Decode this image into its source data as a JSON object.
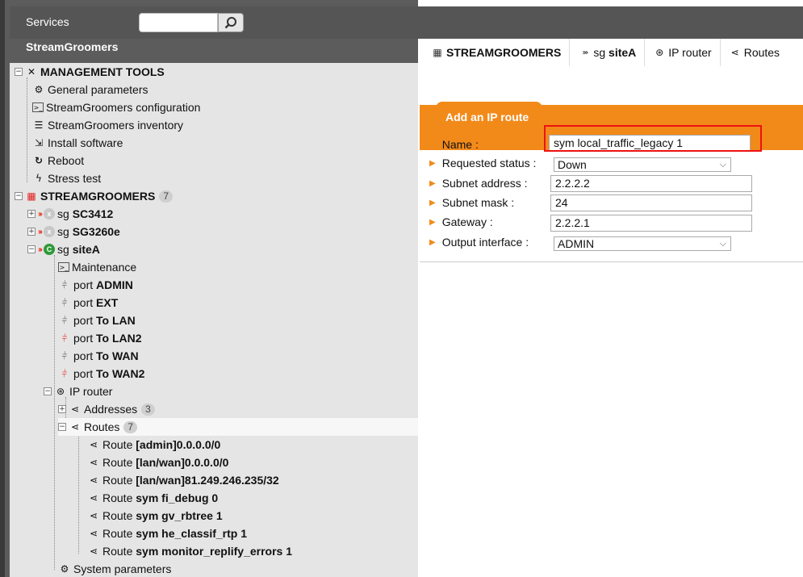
{
  "header": {
    "services_label": "Services",
    "search_placeholder": "",
    "brand": "StreamGroomers"
  },
  "tree": {
    "management_tools": "MANAGEMENT TOOLS",
    "general_parameters": "General parameters",
    "sg_configuration": "StreamGroomers configuration",
    "sg_inventory": "StreamGroomers inventory",
    "install_software": "Install software",
    "reboot": "Reboot",
    "stress_test": "Stress test",
    "streamgroomers": "STREAMGROOMERS",
    "streamgroomers_count": "7",
    "sg_prefix": "sg",
    "sg1_name": "SC3412",
    "sg2_name": "SG3260e",
    "sg3_name": "siteA",
    "maintenance": "Maintenance",
    "port_prefix": "port",
    "ports": [
      "ADMIN",
      "EXT",
      "To LAN",
      "To LAN2",
      "To WAN",
      "To WAN2"
    ],
    "ip_router": "IP router",
    "addresses": "Addresses",
    "addresses_count": "3",
    "routes": "Routes",
    "routes_count": "7",
    "route_prefix": "Route",
    "route_items": [
      "[admin]0.0.0.0/0",
      "[lan/wan]0.0.0.0/0",
      "[lan/wan]81.249.246.235/32",
      "sym fi_debug 0",
      "sym gv_rbtree 1",
      "sym he_classif_rtp 1",
      "sym monitor_replify_errors 1"
    ],
    "system_parameters": "System parameters"
  },
  "tabs": {
    "t1": "STREAMGROOMERS",
    "t2_prefix": "sg",
    "t2_name": "siteA",
    "t3": "IP router",
    "t4": "Routes"
  },
  "form": {
    "title": "Add an IP route",
    "name_label": "Name :",
    "name_value": "sym local_traffic_legacy 1",
    "status_label": "Requested status :",
    "status_value": "Down",
    "subnet_label": "Subnet address :",
    "subnet_value": "2.2.2.2",
    "mask_label": "Subnet mask :",
    "mask_value": "24",
    "gateway_label": "Gateway :",
    "gateway_value": "2.2.2.1",
    "output_label": "Output interface :",
    "output_value": "ADMIN"
  },
  "colors": {
    "accent_orange": "#f28a1a",
    "highlight_red": "#e11111",
    "frame_gray": "#555555",
    "tree_bg": "#e5e5e5"
  }
}
